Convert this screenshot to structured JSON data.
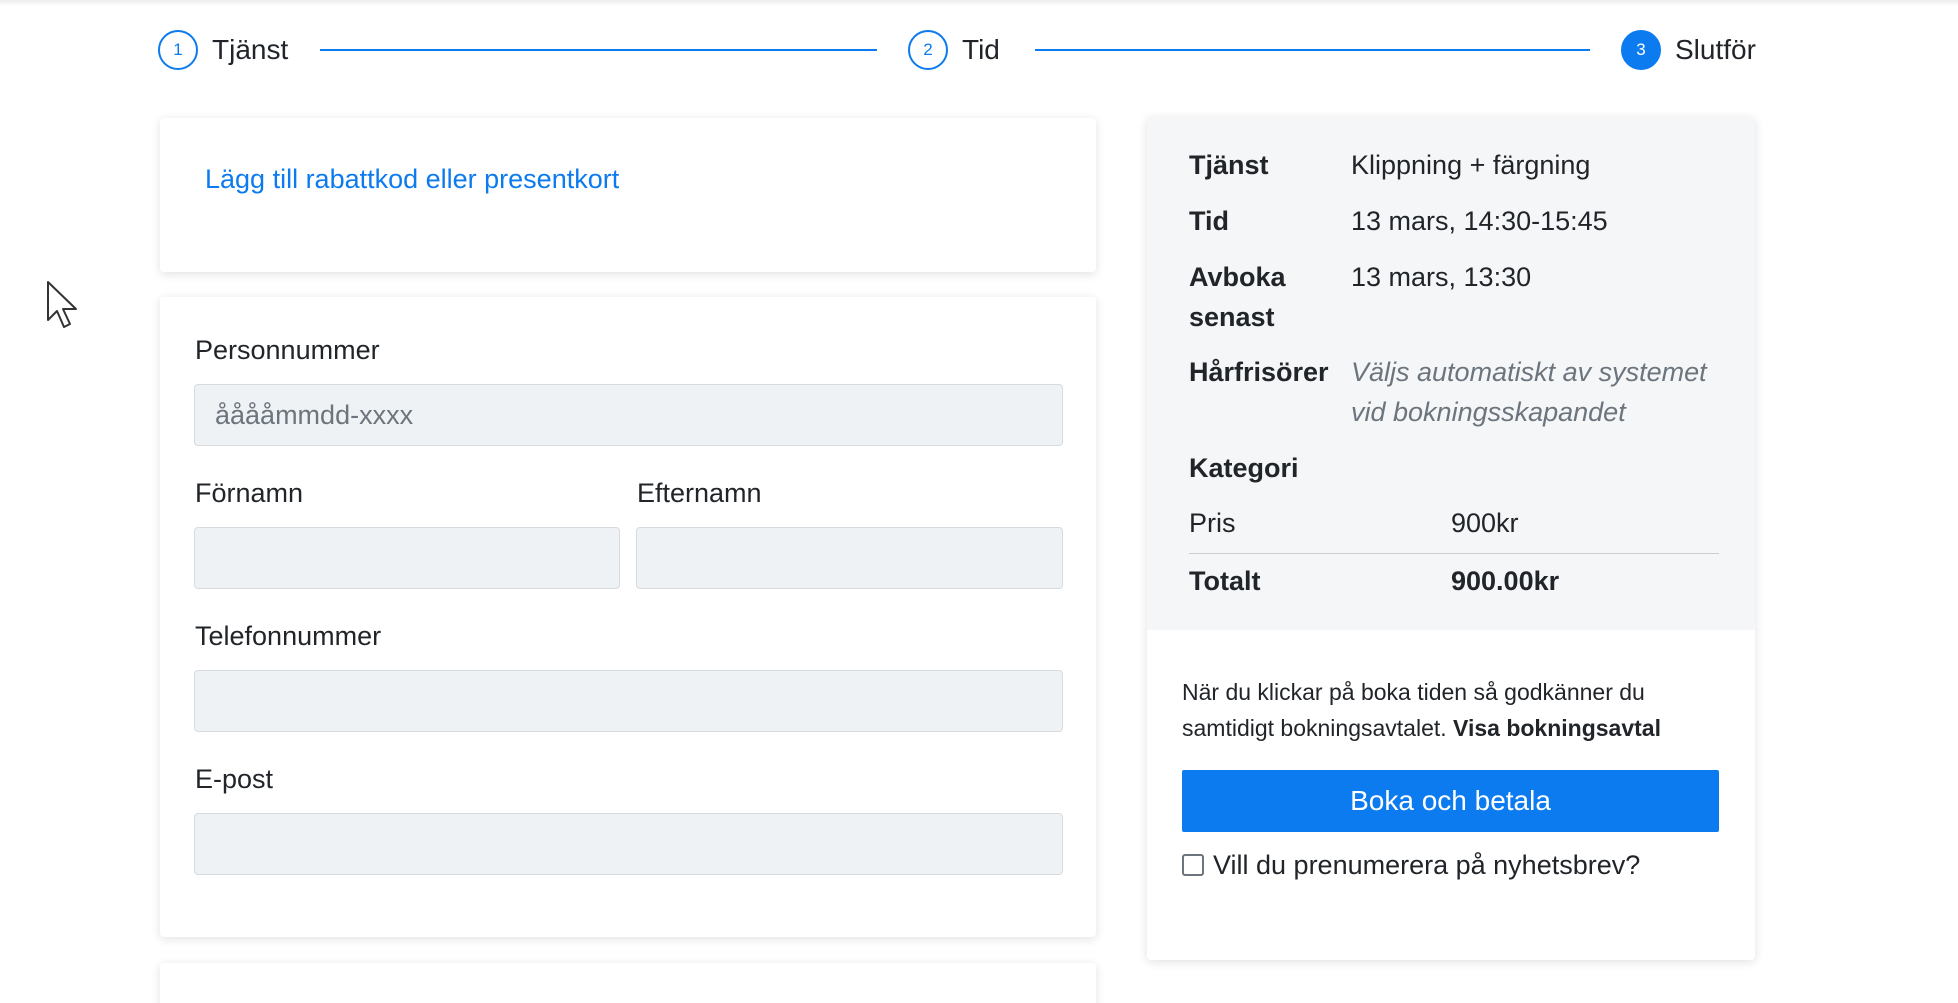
{
  "stepper": {
    "steps": [
      {
        "number": "1",
        "label": "Tjänst",
        "state": "done"
      },
      {
        "number": "2",
        "label": "Tid",
        "state": "done"
      },
      {
        "number": "3",
        "label": "Slutför",
        "state": "active"
      }
    ],
    "accent": "#0d7bf0"
  },
  "discount": {
    "link_text": "Lägg till rabattkod eller presentkort"
  },
  "form": {
    "personnummer_label": "Personnummer",
    "personnummer_placeholder": "ååååmmdd-xxxx",
    "personnummer_value": "",
    "fornamn_label": "Förnamn",
    "fornamn_value": "",
    "efternamn_label": "Efternamn",
    "efternamn_value": "",
    "telefon_label": "Telefonnummer",
    "telefon_value": "",
    "epost_label": "E-post",
    "epost_value": ""
  },
  "summary": {
    "tjanst_key": "Tjänst",
    "tjanst_val": "Klippning + färgning",
    "tid_key": "Tid",
    "tid_val": "13 mars, 14:30-15:45",
    "avboka_key_1": "Avboka",
    "avboka_key_2": "senast",
    "avboka_val": "13 mars, 13:30",
    "harfrisor_key": "Hårfrisörer",
    "harfrisor_val_1": "Väljs automatiskt av systemet",
    "harfrisor_val_2": "vid bokningsskapandet",
    "kategori_key": "Kategori",
    "pris_key": "Pris",
    "pris_val": "900kr",
    "totalt_key": "Totalt",
    "totalt_val": "900.00kr"
  },
  "checkout": {
    "terms_line_1": "När du klickar på boka tiden så godkänner du",
    "terms_line_2": "samtidigt bokningsavtalet.",
    "terms_link": "Visa bokningsavtal",
    "book_button": "Boka och betala",
    "newsletter_label": "Vill du prenumerera på nyhetsbrev?"
  }
}
